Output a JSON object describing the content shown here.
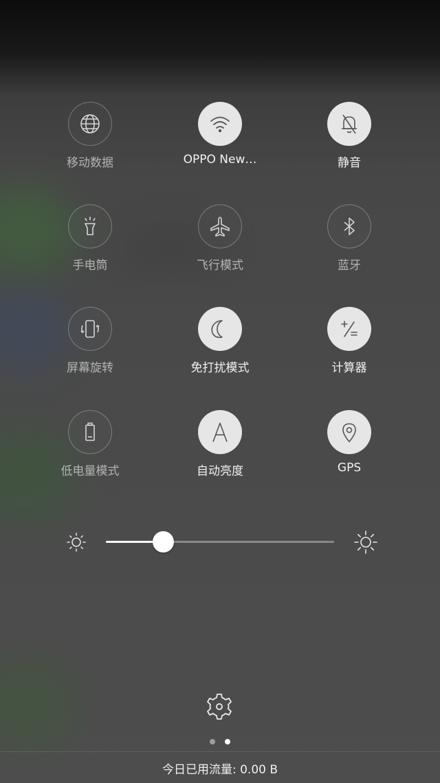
{
  "tiles": [
    {
      "label": "移动数据",
      "icon": "globe-icon",
      "active": false
    },
    {
      "label": "OPPO New…",
      "icon": "wifi-icon",
      "active": true
    },
    {
      "label": "静音",
      "icon": "bell-muted-icon",
      "active": true
    },
    {
      "label": "手电筒",
      "icon": "flashlight-icon",
      "active": false
    },
    {
      "label": "飞行模式",
      "icon": "airplane-icon",
      "active": false
    },
    {
      "label": "蓝牙",
      "icon": "bluetooth-icon",
      "active": false
    },
    {
      "label": "屏幕旋转",
      "icon": "screen-rotate-icon",
      "active": false
    },
    {
      "label": "免打扰模式",
      "icon": "moon-icon",
      "active": true
    },
    {
      "label": "计算器",
      "icon": "calculator-icon",
      "active": true
    },
    {
      "label": "低电量模式",
      "icon": "battery-low-icon",
      "active": false
    },
    {
      "label": "自动亮度",
      "icon": "auto-brightness-icon",
      "active": true
    },
    {
      "label": "GPS",
      "icon": "location-pin-icon",
      "active": true
    }
  ],
  "brightness": {
    "level": 0.25,
    "min_icon": "sun-dim-icon",
    "max_icon": "sun-bright-icon"
  },
  "settings_icon": "gear-icon",
  "pager": {
    "count": 2,
    "active_index": 1
  },
  "footer": {
    "data_usage": "今日已用流量: 0.00 B"
  },
  "colors": {
    "active_circle": "#e6e6e6",
    "active_label": "#f2f2f2",
    "inactive_label": "#b3b3b3"
  }
}
